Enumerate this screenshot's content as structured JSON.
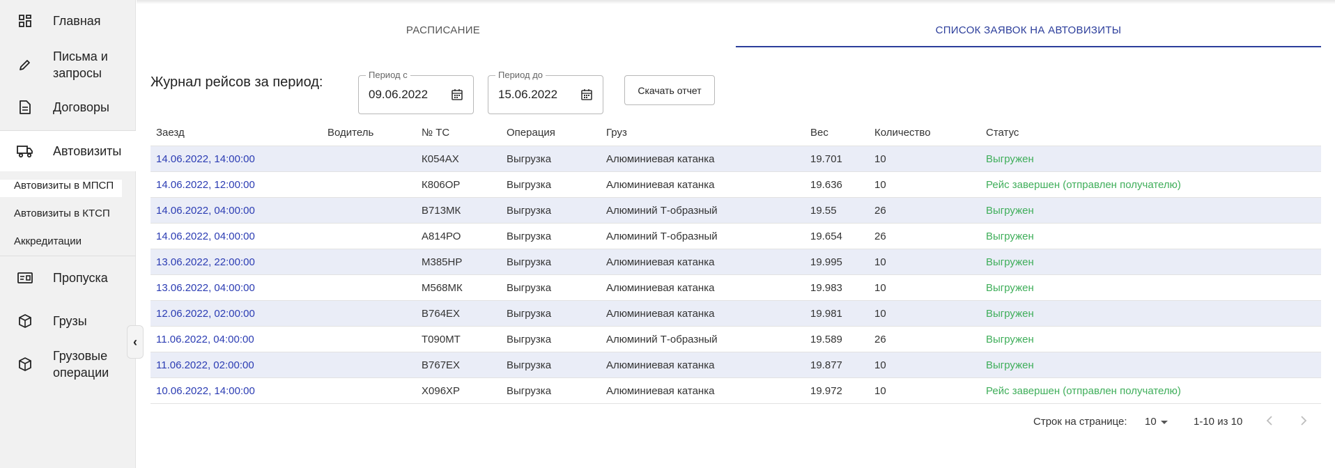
{
  "sidebar": {
    "items": [
      {
        "label": "Главная",
        "icon": "dashboard-icon"
      },
      {
        "label": "Письма и\nзапросы",
        "icon": "pencil-icon"
      },
      {
        "label": "Договоры",
        "icon": "document-icon"
      },
      {
        "label": "Автовизиты",
        "icon": "truck-icon"
      },
      {
        "label": "Пропуска",
        "icon": "id-card-icon"
      },
      {
        "label": "Грузы",
        "icon": "box-icon"
      },
      {
        "label": "Грузовые\nоперации",
        "icon": "box-icon"
      }
    ],
    "subitems": [
      "Автовизиты в МПСП",
      "Автовизиты в КТСП",
      "Аккредитации"
    ],
    "collapse_icon": "‹"
  },
  "tabs": [
    "РАСПИСАНИЕ",
    "СПИСОК ЗАЯВОК НА АВТОВИЗИТЫ"
  ],
  "journal": {
    "title": "Журнал рейсов за период:",
    "from_label": "Период с",
    "from_value": "09.06.2022",
    "to_label": "Период до",
    "to_value": "15.06.2022",
    "download_label": "Скачать отчет"
  },
  "table": {
    "headers": [
      "Заезд",
      "Водитель",
      "№ ТС",
      "Операция",
      "Груз",
      "Вес",
      "Количество",
      "Статус"
    ],
    "rows": [
      [
        "14.06.2022, 14:00:00",
        "",
        "К054АХ",
        "Выгрузка",
        "Алюминиевая катанка",
        "19.701",
        "10",
        "Выгружен"
      ],
      [
        "14.06.2022, 12:00:00",
        "",
        "К806ОР",
        "Выгрузка",
        "Алюминиевая катанка",
        "19.636",
        "10",
        "Рейс завершен (отправлен получателю)"
      ],
      [
        "14.06.2022, 04:00:00",
        "",
        "В713МК",
        "Выгрузка",
        "Алюминий Т-образный",
        "19.55",
        "26",
        "Выгружен"
      ],
      [
        "14.06.2022, 04:00:00",
        "",
        "А814РО",
        "Выгрузка",
        "Алюминий Т-образный",
        "19.654",
        "26",
        "Выгружен"
      ],
      [
        "13.06.2022, 22:00:00",
        "",
        "М385НР",
        "Выгрузка",
        "Алюминиевая катанка",
        "19.995",
        "10",
        "Выгружен"
      ],
      [
        "13.06.2022, 04:00:00",
        "",
        "М568МК",
        "Выгрузка",
        "Алюминиевая катанка",
        "19.983",
        "10",
        "Выгружен"
      ],
      [
        "12.06.2022, 02:00:00",
        "",
        "В764ЕХ",
        "Выгрузка",
        "Алюминиевая катанка",
        "19.981",
        "10",
        "Выгружен"
      ],
      [
        "11.06.2022, 04:00:00",
        "",
        "Т090МТ",
        "Выгрузка",
        "Алюминий Т-образный",
        "19.589",
        "26",
        "Выгружен"
      ],
      [
        "11.06.2022, 02:00:00",
        "",
        "В767ЕХ",
        "Выгрузка",
        "Алюминиевая катанка",
        "19.877",
        "10",
        "Выгружен"
      ],
      [
        "10.06.2022, 14:00:00",
        "",
        "Х096ХР",
        "Выгрузка",
        "Алюминиевая катанка",
        "19.972",
        "10",
        "Рейс завершен (отправлен получателю)"
      ]
    ]
  },
  "pagination": {
    "rows_label": "Строк на странице:",
    "rows_value": "10",
    "range": "1-10 из 10"
  },
  "colors": {
    "accent": "#2c3e9b",
    "link": "#2b3cb3",
    "status": "#3fae5a",
    "row_stripe": "#eaedf7",
    "sidebar_bg": "#f1f1f1"
  }
}
